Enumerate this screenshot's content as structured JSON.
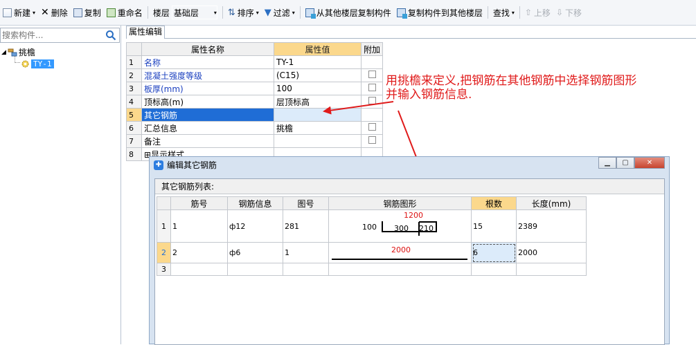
{
  "toolbar": {
    "new": "新建",
    "delete": "删除",
    "copy": "复制",
    "rename": "重命名",
    "floor_label": "楼层",
    "floor_value": "基础层",
    "sort": "排序",
    "filter": "过滤",
    "copy_from_other": "从其他楼层复制构件",
    "copy_to_other": "复制构件到其他楼层",
    "find": "查找",
    "move_up": "上移",
    "move_down": "下移"
  },
  "left": {
    "search_placeholder": "搜索构件...",
    "tree": {
      "root": "挑檐",
      "child": "TY-1"
    }
  },
  "properties": {
    "tab": "属性编辑",
    "headers": [
      "属性名称",
      "属性值",
      "附加"
    ],
    "rows": [
      {
        "num": "1",
        "name": "名称",
        "value": "TY-1",
        "check": false
      },
      {
        "num": "2",
        "name": "混凝土强度等级",
        "value": "(C15)",
        "check": true
      },
      {
        "num": "3",
        "name": "板厚(mm)",
        "value": "100",
        "check": true
      },
      {
        "num": "4",
        "name": "顶标高(m)",
        "value": "层顶标高",
        "check": true
      },
      {
        "num": "5",
        "name": "其它钢筋",
        "value": "",
        "check": false
      },
      {
        "num": "6",
        "name": "汇总信息",
        "value": "挑檐",
        "check": true
      },
      {
        "num": "7",
        "name": "备注",
        "value": "",
        "check": true
      },
      {
        "num": "8",
        "name": "显示样式",
        "value": "",
        "check": false
      }
    ]
  },
  "annotation": {
    "line1": "用挑檐来定义,把钢筋在其他钢筋中选择钢筋图形",
    "line2": "并输入钢筋信息."
  },
  "dialog": {
    "title": "编辑其它钢筋",
    "list_label": "其它钢筋列表:",
    "headers": [
      "筋号",
      "钢筋信息",
      "图号",
      "钢筋图形",
      "根数",
      "长度(mm)"
    ],
    "rows": [
      {
        "num": "1",
        "bar_no": "1",
        "info": "ф12",
        "fig_no": "281",
        "count": "15",
        "length": "2389",
        "shape": {
          "top": "1200",
          "left": "100",
          "mid": "300",
          "right": "210"
        }
      },
      {
        "num": "2",
        "bar_no": "2",
        "info": "ф6",
        "fig_no": "1",
        "count": "6",
        "length": "2000",
        "shape": {
          "top": "2000"
        }
      },
      {
        "num": "3",
        "bar_no": "",
        "info": "",
        "fig_no": "",
        "count": "",
        "length": "",
        "shape": {}
      }
    ]
  },
  "colors": {
    "annotation_red": "#e01b1b",
    "header_orange": "#fbd88c",
    "selection_blue": "#1f6dd6"
  }
}
